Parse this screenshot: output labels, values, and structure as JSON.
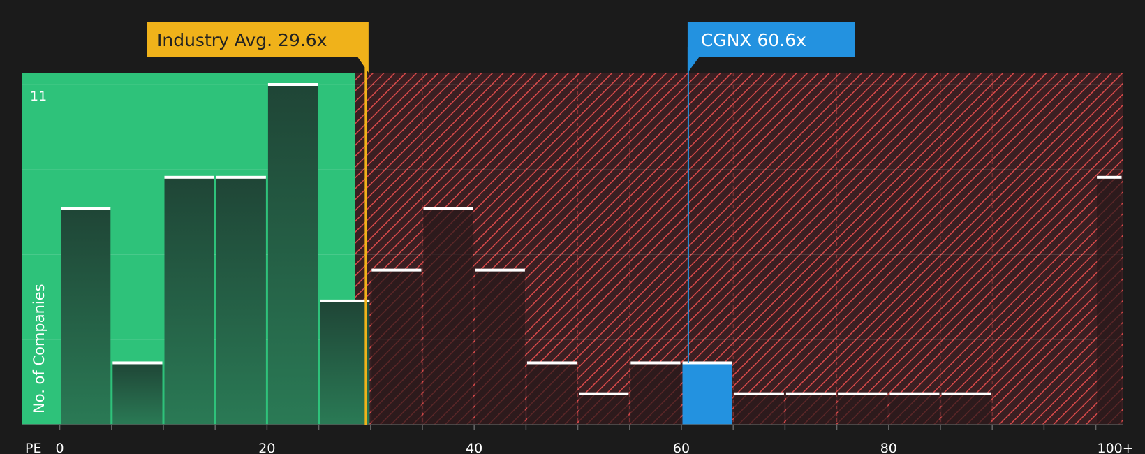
{
  "chart_data": {
    "type": "bar",
    "x_label": "PE",
    "y_label": "No. of Companies",
    "y_max_label": "11",
    "ylim": [
      0,
      11
    ],
    "x_ticks": [
      {
        "value": 0,
        "label": "0"
      },
      {
        "value": 20,
        "label": "20"
      },
      {
        "value": 40,
        "label": "40"
      },
      {
        "value": 60,
        "label": "60"
      },
      {
        "value": 80,
        "label": "80"
      },
      {
        "value": 100,
        "label": "100+"
      }
    ],
    "bins": [
      {
        "start": 0,
        "end": 5,
        "count": 7
      },
      {
        "start": 5,
        "end": 10,
        "count": 2
      },
      {
        "start": 10,
        "end": 15,
        "count": 8
      },
      {
        "start": 15,
        "end": 20,
        "count": 8
      },
      {
        "start": 20,
        "end": 25,
        "count": 11
      },
      {
        "start": 25,
        "end": 30,
        "count": 4
      },
      {
        "start": 30,
        "end": 35,
        "count": 5
      },
      {
        "start": 35,
        "end": 40,
        "count": 7
      },
      {
        "start": 40,
        "end": 45,
        "count": 5
      },
      {
        "start": 45,
        "end": 50,
        "count": 2
      },
      {
        "start": 50,
        "end": 55,
        "count": 1
      },
      {
        "start": 55,
        "end": 60,
        "count": 2
      },
      {
        "start": 60,
        "end": 65,
        "count": 2,
        "highlight": true
      },
      {
        "start": 65,
        "end": 70,
        "count": 1
      },
      {
        "start": 70,
        "end": 75,
        "count": 1
      },
      {
        "start": 75,
        "end": 80,
        "count": 1
      },
      {
        "start": 80,
        "end": 85,
        "count": 1
      },
      {
        "start": 85,
        "end": 90,
        "count": 1
      },
      {
        "start": 100,
        "end": 105,
        "count": 8
      }
    ],
    "fair_zone_end": 28.5,
    "industry_avg": {
      "label": "Industry Avg. 29.6x",
      "value": 29.6
    },
    "company": {
      "label": "CGNX 60.6x",
      "value": 60.6
    },
    "colors": {
      "background": "#1b1b1b",
      "green_zone": "#2ec27a",
      "red_zone": "#3a1f22",
      "hatch": "#d94a4a",
      "bar_dark": "#22493a",
      "highlight": "#2392e0",
      "industry": "#f0b21a",
      "company": "#2392e0"
    },
    "grid": true
  }
}
